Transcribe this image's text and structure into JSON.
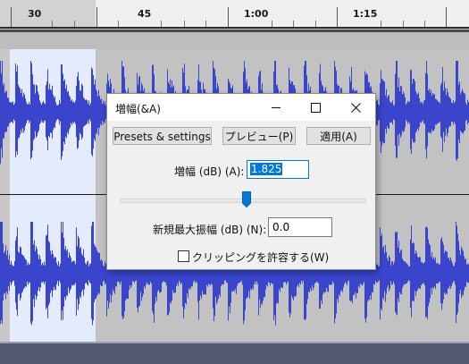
{
  "ruler": {
    "labels": [
      "30",
      "45",
      "1:00",
      "1:15"
    ]
  },
  "dialog": {
    "title": "増幅(&A)",
    "buttons": {
      "presets": "Presets & settings",
      "preview": "プレビュー(P)",
      "apply": "適用(A)"
    },
    "amplification": {
      "label": "増幅 (dB) (A):",
      "value": "1.825"
    },
    "new_peak": {
      "label": "新規最大振幅 (dB) (N):",
      "value": "0.0"
    },
    "allow_clipping": {
      "label": "クリッピングを許容する(W)",
      "checked": false
    },
    "slider_level": 0.52
  },
  "colors": {
    "waveform": "#3a45cc",
    "selection": "#e3ebfd",
    "accent": "#0078d7"
  }
}
